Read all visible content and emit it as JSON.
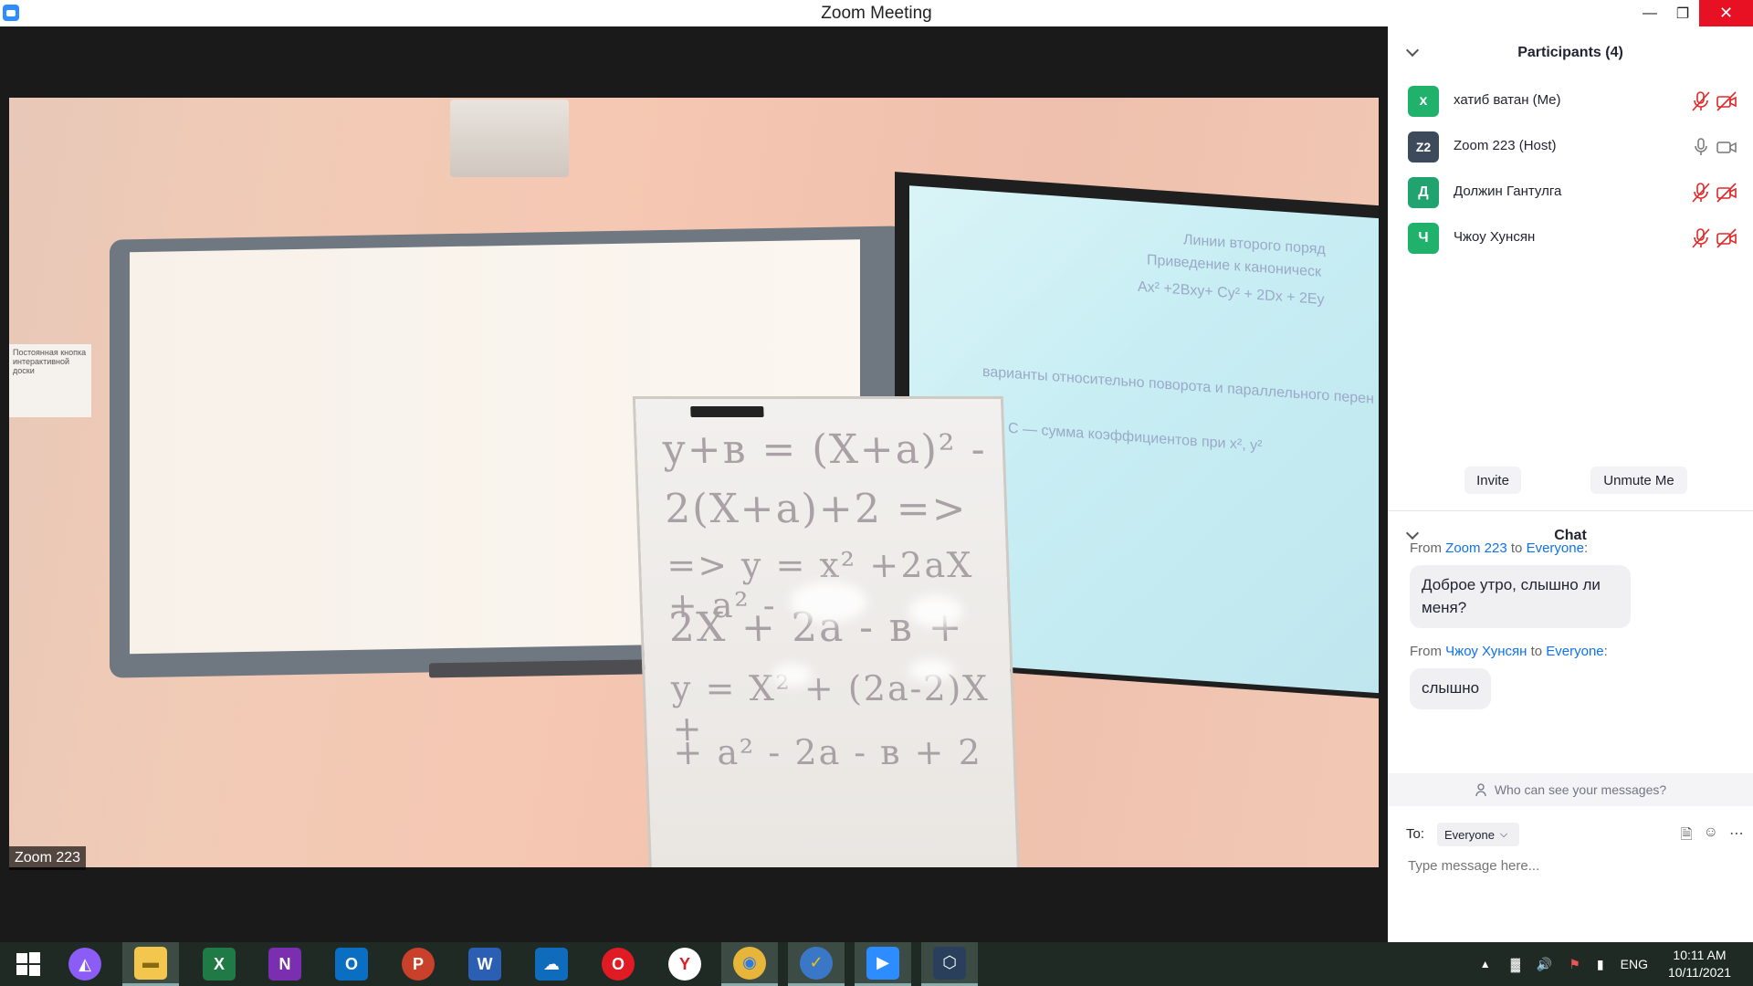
{
  "window": {
    "title": "Zoom Meeting"
  },
  "video": {
    "speaker_label": "Zoom 223",
    "flipchart_lines": [
      "y+в = (X+a)² -",
      "2(X+a)+2 =>",
      "=> y = x² +2aX + a² -",
      "2X + 2a - в +",
      "y = X² + (2a-2)X +",
      "+ a² - 2a - в + 2"
    ],
    "screen_lines": [
      "Линии второго поряд",
      "Приведение к каноническ",
      "Ax² +2Bxy+ Cy² + 2Dx + 2Ey",
      "варианты относительно поворота и параллельного перен",
      "A + C — сумма коэффициентов при x², y²"
    ],
    "paper_note": "Постоянная кнопка интерактивной доски"
  },
  "participants": {
    "title": "Participants (4)",
    "items": [
      {
        "initial": "х",
        "name": "хатиб ватан (Me)",
        "color": "#20b26b",
        "muted": true,
        "video_off": true
      },
      {
        "initial": "Z2",
        "name": "Zoom 223 (Host)",
        "color": "#3d4a5c",
        "muted": false,
        "video_off": false
      },
      {
        "initial": "Д",
        "name": "Должин Гантулга",
        "color": "#20a36f",
        "muted": true,
        "video_off": true
      },
      {
        "initial": "Ч",
        "name": "Чжоу Хунсян",
        "color": "#20b26b",
        "muted": true,
        "video_off": true
      }
    ],
    "invite_label": "Invite",
    "unmute_label": "Unmute Me"
  },
  "chat": {
    "title": "Chat",
    "messages": [
      {
        "from_prefix": "From ",
        "sender": "Zoom 223",
        "to_word": " to ",
        "recipient": "Everyone",
        "suffix": ":",
        "text": "Доброе утро, слышно ли меня?"
      },
      {
        "from_prefix": "From ",
        "sender": "Чжоу Хунсян",
        "to_word": " to ",
        "recipient": "Everyone",
        "suffix": ":",
        "text": "слышно"
      }
    ],
    "who_can_see": "Who can see your messages?",
    "to_label": "To:",
    "to_value": "Everyone",
    "placeholder": "Type message here..."
  },
  "taskbar": {
    "apps": [
      {
        "name": "start",
        "glyph": "⊞",
        "color": "#1f2a25"
      },
      {
        "name": "alice",
        "glyph": "◭",
        "color": "#8c5cf6"
      },
      {
        "name": "explorer",
        "glyph": "▬",
        "color": "#f3c74e"
      },
      {
        "name": "excel",
        "glyph": "X",
        "color": "#1f7a45"
      },
      {
        "name": "onenote",
        "glyph": "N",
        "color": "#7b2fb0"
      },
      {
        "name": "outlook",
        "glyph": "O",
        "color": "#0a6fc2"
      },
      {
        "name": "powerpoint",
        "glyph": "P",
        "color": "#c9412a"
      },
      {
        "name": "word",
        "glyph": "W",
        "color": "#2b5fb4"
      },
      {
        "name": "onedrive",
        "glyph": "☁",
        "color": "#0f6cbd"
      },
      {
        "name": "opera",
        "glyph": "O",
        "color": "#e01b24"
      },
      {
        "name": "yandex",
        "glyph": "Y",
        "color": "#ffffff"
      },
      {
        "name": "chrome",
        "glyph": "◉",
        "color": "#e8b53b"
      },
      {
        "name": "todo",
        "glyph": "✓",
        "color": "#3a78c7"
      },
      {
        "name": "zoom",
        "glyph": "▶",
        "color": "#2d8cff"
      },
      {
        "name": "virtualbox",
        "glyph": "⬡",
        "color": "#2a3f5c"
      }
    ],
    "language": "ENG",
    "time": "10:11 AM",
    "date": "10/11/2021"
  }
}
